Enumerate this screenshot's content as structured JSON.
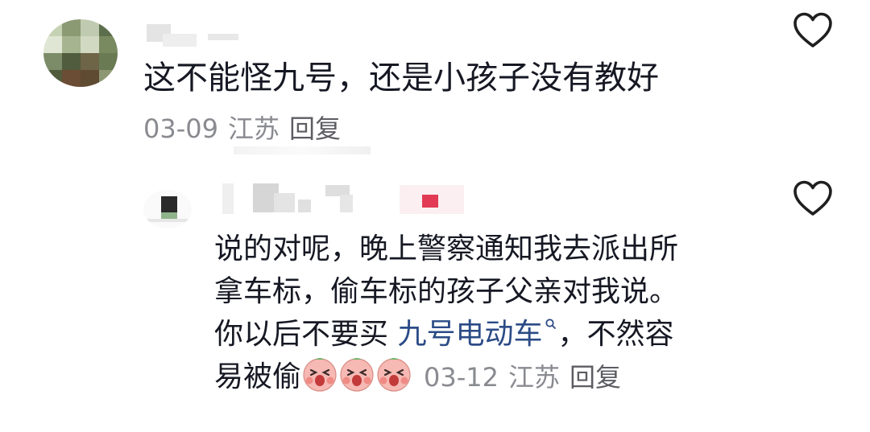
{
  "comment": {
    "text": "这不能怪九号，还是小孩子没有教好",
    "date": "03-09",
    "location": "江苏",
    "reply_label": "回复",
    "like_icon": "heart-outline-icon"
  },
  "reply": {
    "lines": [
      "说的对呢，晚上警察通知我去派出所",
      "拿车标，偷车标的孩子父亲对我说。",
      "你以后不要买 "
    ],
    "topic_link": "九号电动车",
    "after_link": "，不然容",
    "last_line": "易被偷",
    "emojis": [
      "crying-face-emoji",
      "crying-face-emoji",
      "crying-face-emoji"
    ],
    "date": "03-12",
    "location": "江苏",
    "reply_label": "回复",
    "like_icon": "heart-outline-icon"
  },
  "colors": {
    "text_primary": "#161823",
    "text_meta": "#8a8b91",
    "link": "#2b4b86",
    "icon_stroke": "#1f1f1f"
  }
}
